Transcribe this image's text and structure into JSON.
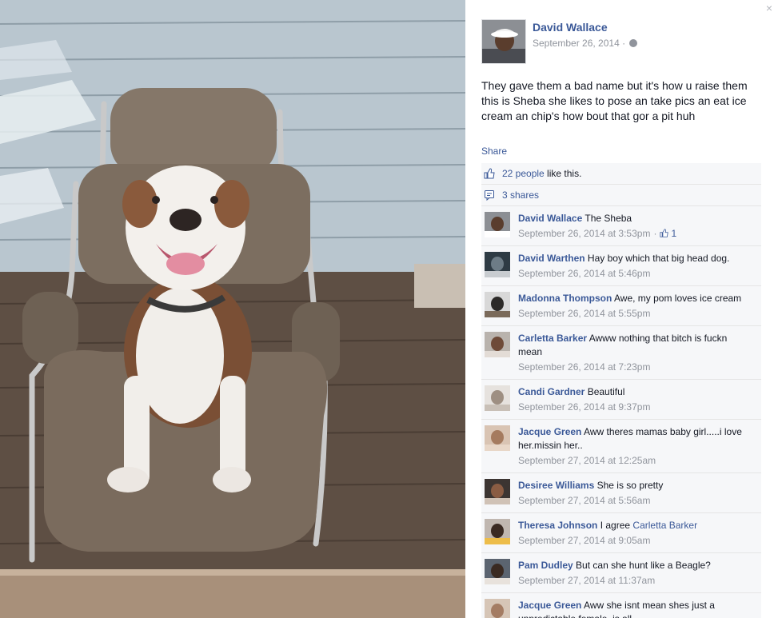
{
  "close_label": "×",
  "post": {
    "author": "David Wallace",
    "date": "September 26, 2014",
    "separator": "·",
    "caption": "They gave them a bad name but it's how u raise them this is Sheba she likes to pose an take pics an eat ice cream an chip's how bout that gor a pit huh",
    "share_label": "Share"
  },
  "feedback": {
    "likes_link": "22 people",
    "likes_suffix": " like this.",
    "shares_link": "3 shares"
  },
  "comments": [
    {
      "author": "David Wallace",
      "text": "The Sheba",
      "time": "September 26, 2014 at 3:53pm",
      "likes": "1"
    },
    {
      "author": "David Warthen",
      "text": "Hay boy which that big head dog.",
      "time": "September 26, 2014 at 5:46pm"
    },
    {
      "author": "Madonna Thompson",
      "text": "Awe, my pom loves ice cream",
      "time": "September 26, 2014 at 5:55pm"
    },
    {
      "author": "Carletta Barker",
      "text": "Awww nothing that bitch is fuckn mean",
      "time": "September 26, 2014 at 7:23pm"
    },
    {
      "author": "Candi Gardner",
      "text": "Beautiful",
      "time": "September 26, 2014 at 9:37pm"
    },
    {
      "author": "Jacque Green",
      "text": "Aww theres mamas baby girl.....i love her.missin her..",
      "time": "September 27, 2014 at 12:25am"
    },
    {
      "author": "Desiree Williams",
      "text": "She is so pretty",
      "time": "September 27, 2014 at 5:56am"
    },
    {
      "author": "Theresa Johnson",
      "text": "I agree",
      "mention": "Carletta Barker",
      "time": "September 27, 2014 at 9:05am"
    },
    {
      "author": "Pam Dudley",
      "text": "But can she hunt like a Beagle?",
      "time": "September 27, 2014 at 11:37am"
    },
    {
      "author": "Jacque Green",
      "text": "Aww she isnt mean shes just a unpredictable female..is all.",
      "time": ""
    }
  ],
  "colors": {
    "link": "#3b5998",
    "meta": "#90949c",
    "panel": "#f6f7f9"
  }
}
